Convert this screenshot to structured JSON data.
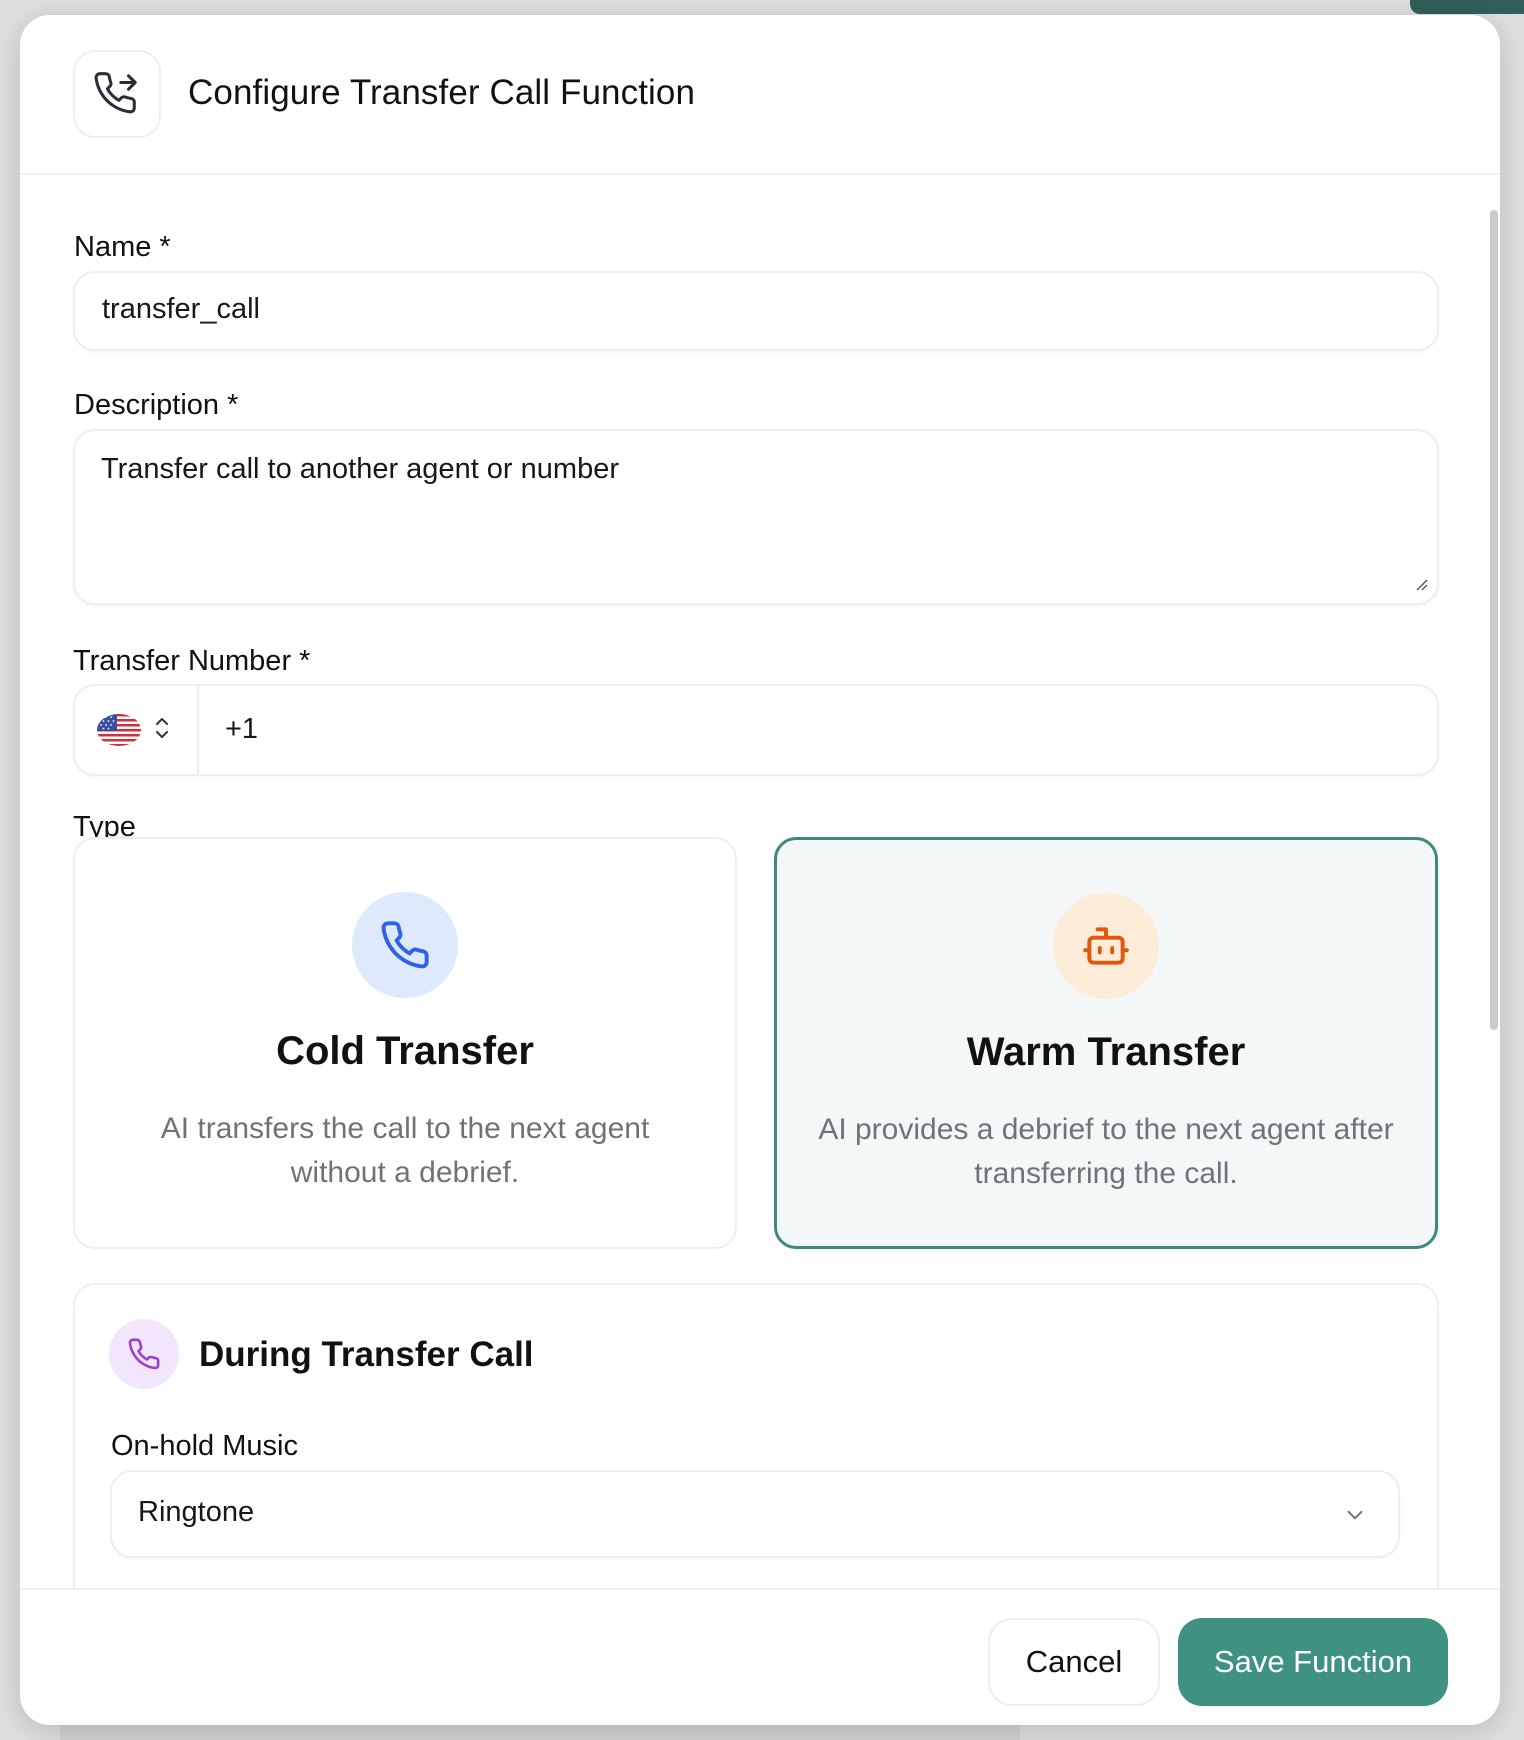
{
  "dialog": {
    "title": "Configure Transfer Call Function",
    "header_icon": "phone-forward-icon"
  },
  "form": {
    "name": {
      "label": "Name *",
      "value": "transfer_call"
    },
    "description": {
      "label": "Description *",
      "value": "Transfer call to another agent or number"
    },
    "transfer_number": {
      "label": "Transfer Number *",
      "country_flag": "us-flag-icon",
      "value": "+1"
    },
    "type": {
      "label": "Type",
      "options": [
        {
          "title": "Cold Transfer",
          "description": "AI transfers the call to the next agent without a debrief.",
          "icon": "phone-icon",
          "selected": false,
          "icon_color": "#2f62e5",
          "icon_bg": "#dfe9fd"
        },
        {
          "title": "Warm Transfer",
          "description": "AI provides a debrief to the next agent after transferring the call.",
          "icon": "bot-icon",
          "selected": true,
          "icon_color": "#e2560e",
          "icon_bg": "#fdecd8"
        }
      ]
    },
    "during_transfer": {
      "title": "During Transfer Call",
      "icon": "phone-icon",
      "icon_color": "#9a3fd0",
      "on_hold_music": {
        "label": "On-hold Music",
        "value": "Ringtone"
      }
    }
  },
  "footer": {
    "cancel_label": "Cancel",
    "save_label": "Save Function",
    "accent_color": "#3f9180"
  }
}
